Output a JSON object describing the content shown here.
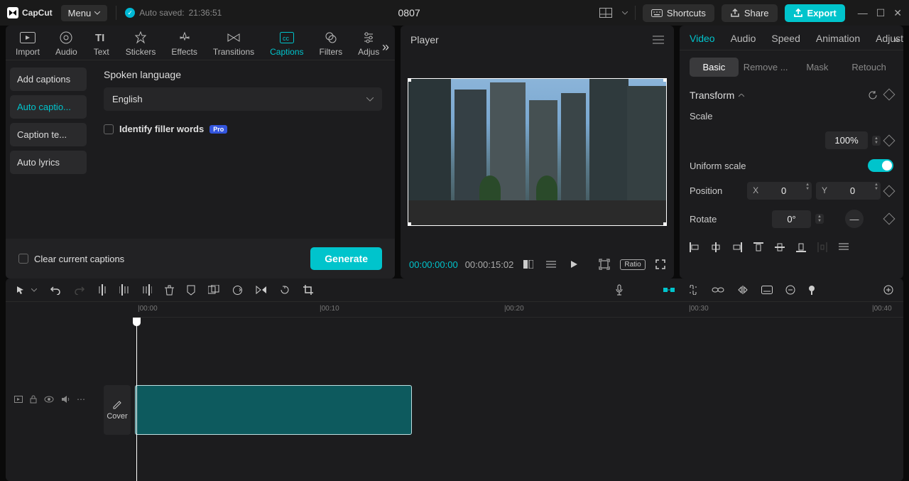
{
  "app": {
    "name": "CapCut",
    "menu": "Menu"
  },
  "autosave": {
    "label": "Auto saved:",
    "time": "21:36:51"
  },
  "project": {
    "title": "0807"
  },
  "titlebar": {
    "shortcuts": "Shortcuts",
    "share": "Share",
    "export": "Export"
  },
  "mediaTabs": {
    "import": "Import",
    "audio": "Audio",
    "text": "Text",
    "stickers": "Stickers",
    "effects": "Effects",
    "transitions": "Transitions",
    "captions": "Captions",
    "filters": "Filters",
    "adjust": "Adjus"
  },
  "captionsPanel": {
    "sidebar": {
      "add": "Add captions",
      "auto": "Auto captio...",
      "templates": "Caption te...",
      "lyrics": "Auto lyrics"
    },
    "spokenLang": "Spoken language",
    "language": "English",
    "fillerWords": "Identify filler words",
    "proBadge": "Pro",
    "clearCaptions": "Clear current captions",
    "generate": "Generate"
  },
  "player": {
    "title": "Player",
    "currentTime": "00:00:00:00",
    "totalTime": "00:00:15:02",
    "ratio": "Ratio"
  },
  "inspector": {
    "tabs": {
      "video": "Video",
      "audio": "Audio",
      "speed": "Speed",
      "animation": "Animation",
      "adjust": "Adjust"
    },
    "subtabs": {
      "basic": "Basic",
      "remove": "Remove ...",
      "mask": "Mask",
      "retouch": "Retouch"
    },
    "transform": "Transform",
    "scale": "Scale",
    "scaleValue": "100%",
    "uniformScale": "Uniform scale",
    "position": "Position",
    "posX": "X",
    "posXVal": "0",
    "posY": "Y",
    "posYVal": "0",
    "rotate": "Rotate",
    "rotateVal": "0°"
  },
  "timeline": {
    "marks": [
      "00:00",
      "00:10",
      "00:20",
      "00:30",
      "00:40"
    ],
    "cover": "Cover"
  }
}
